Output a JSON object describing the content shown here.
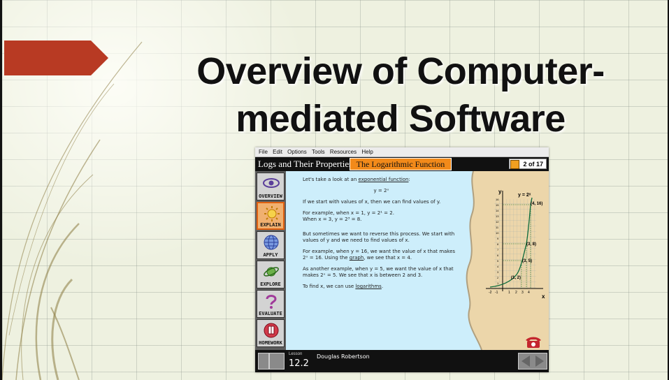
{
  "slide": {
    "title": "Overview of Computer-mediated Software"
  },
  "app": {
    "menu": [
      "File",
      "Edit",
      "Options",
      "Tools",
      "Resources",
      "Help"
    ],
    "course_title": "Logs and Their Properties",
    "topic_title": "The Logarithmic Function",
    "page_indicator": "2 of 17",
    "nav": [
      {
        "label": "OVERVIEW",
        "icon": "eye-icon"
      },
      {
        "label": "EXPLAIN",
        "icon": "sun-icon"
      },
      {
        "label": "APPLY",
        "icon": "globe-icon"
      },
      {
        "label": "EXPLORE",
        "icon": "planet-icon"
      },
      {
        "label": "EVALUATE",
        "icon": "question-icon"
      },
      {
        "label": "HOMEWORK",
        "icon": "book-icon"
      }
    ],
    "lesson": {
      "p1_pre": "Let's take a look at an ",
      "p1_link": "exponential function",
      "p1_post": ":",
      "formula": "y = 2ˣ",
      "p2": "If we start with values of x, then we can find values of y.",
      "p3a": "For example, when x = 1, y = 2¹ = 2.",
      "p3b": "When x = 3, y = 2³ = 8.",
      "p4": "But sometimes we want to reverse this process.  We start with values of y and we need to find values of x.",
      "p5_pre": "For example, when y = 16, we want the value of x that makes 2ˣ = 16.  Using the ",
      "p5_link": "graph",
      "p5_post": ", we see that x = 4.",
      "p6": "As another example, when y = 5, we want the value of x that makes 2ˣ = 5.  We see that x is between 2 and 3.",
      "p7_pre": "To find x, we can use ",
      "p7_link": "logarithms",
      "p7_post": "."
    },
    "graph": {
      "func_label": "y = 2ˣ",
      "y_axis": "y",
      "x_axis": "x",
      "points": [
        "(4, 16)",
        "(3, 8)",
        "(3, 5)",
        "(1, 2)"
      ],
      "y_ticks": [
        "16",
        "15",
        "14",
        "13",
        "12",
        "11",
        "10",
        "9",
        "8",
        "7",
        "6",
        "5",
        "4",
        "3",
        "2",
        "1"
      ],
      "x_ticks": [
        "-2",
        "-1",
        "1",
        "2",
        "3",
        "4"
      ]
    },
    "footer": {
      "lesson_label": "Lesson",
      "lesson_number": "12.2",
      "author": "Douglas Robertson"
    }
  }
}
